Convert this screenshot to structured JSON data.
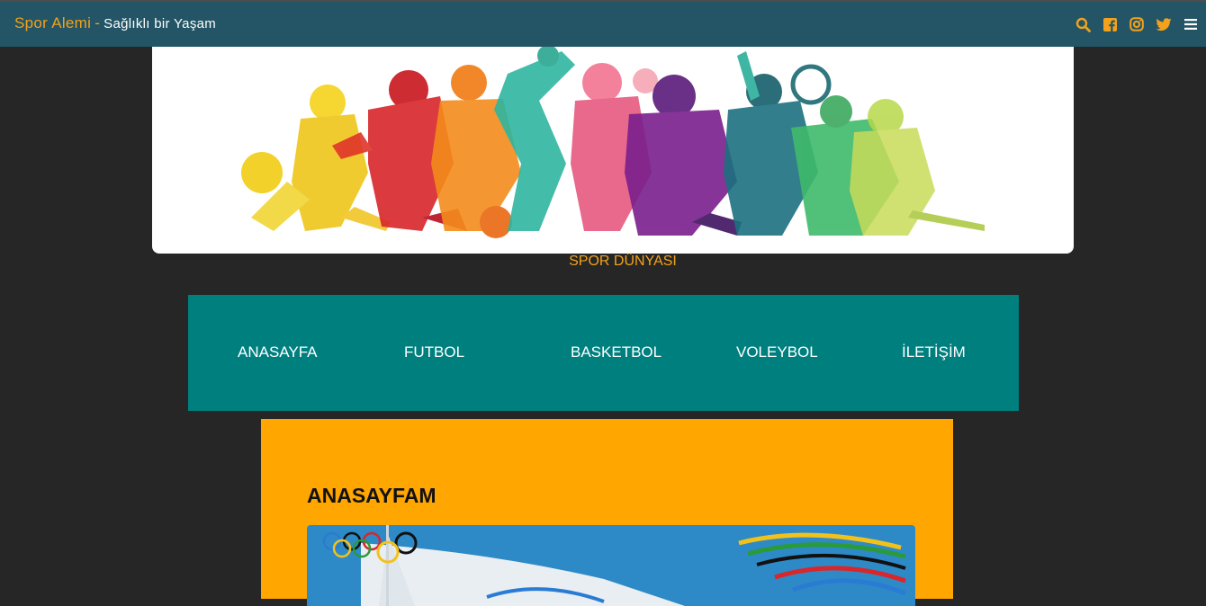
{
  "header": {
    "brand_name": "Spor Alemi",
    "separator": "-",
    "tagline": "Sağlıklı bir Yaşam",
    "icons": [
      "search-icon",
      "facebook-icon",
      "instagram-icon",
      "twitter-icon",
      "menu-icon"
    ],
    "accent_color": "#f2a21c",
    "background_color": "#235566"
  },
  "hero": {
    "caption": "SPOR DÜNYASI"
  },
  "nav": {
    "items": [
      {
        "label": "ANASAYFA"
      },
      {
        "label": "FUTBOL"
      },
      {
        "label": "BASKETBOL"
      },
      {
        "label": "VOLEYBOL"
      },
      {
        "label": "İLETİŞİM"
      }
    ],
    "background_color": "#007f7f"
  },
  "main": {
    "title": "ANASAYFAM",
    "background_color": "#ffa600"
  }
}
